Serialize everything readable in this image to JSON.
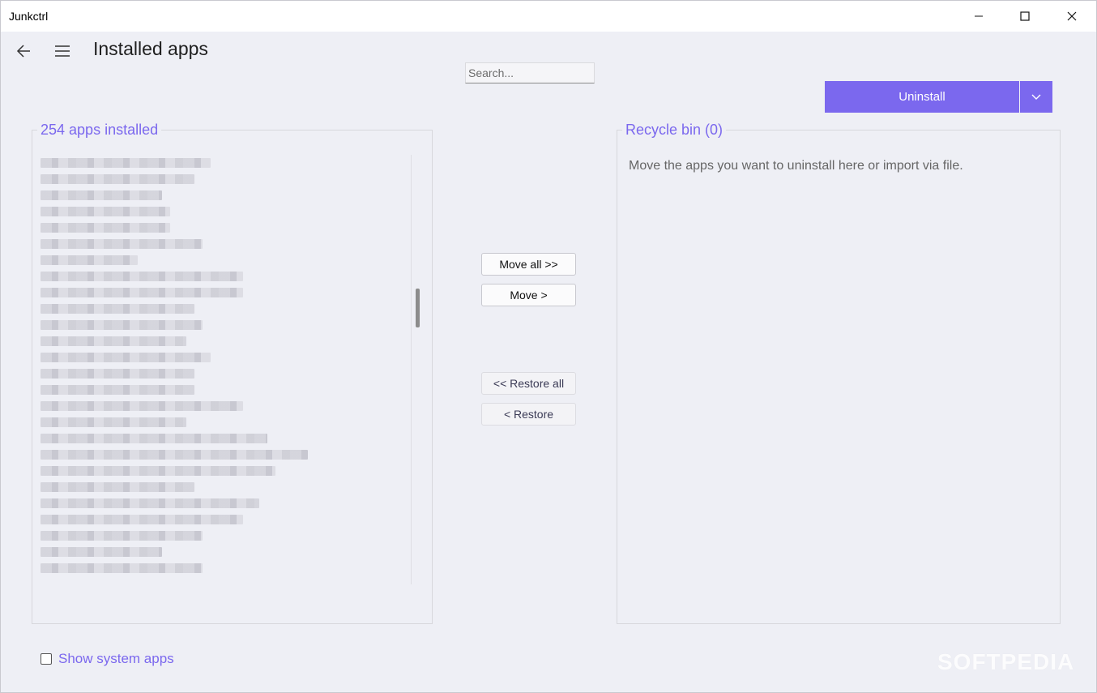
{
  "window": {
    "title": "Junkctrl"
  },
  "header": {
    "page_title": "Installed apps",
    "search_placeholder": "Search..."
  },
  "actions": {
    "uninstall_label": "Uninstall"
  },
  "installed": {
    "legend": "254 apps installed"
  },
  "recycle": {
    "legend": "Recycle bin (0)",
    "hint": "Move the apps you want to uninstall here or import via file."
  },
  "transfer": {
    "move_all": "Move all >>",
    "move": "Move >",
    "restore_all": "<< Restore all",
    "restore": "< Restore"
  },
  "footer": {
    "show_system_apps": "Show system apps",
    "show_system_apps_checked": false
  },
  "watermark": "SOFTPEDIA",
  "colors": {
    "accent": "#7b68ee",
    "background": "#eeeff5"
  }
}
